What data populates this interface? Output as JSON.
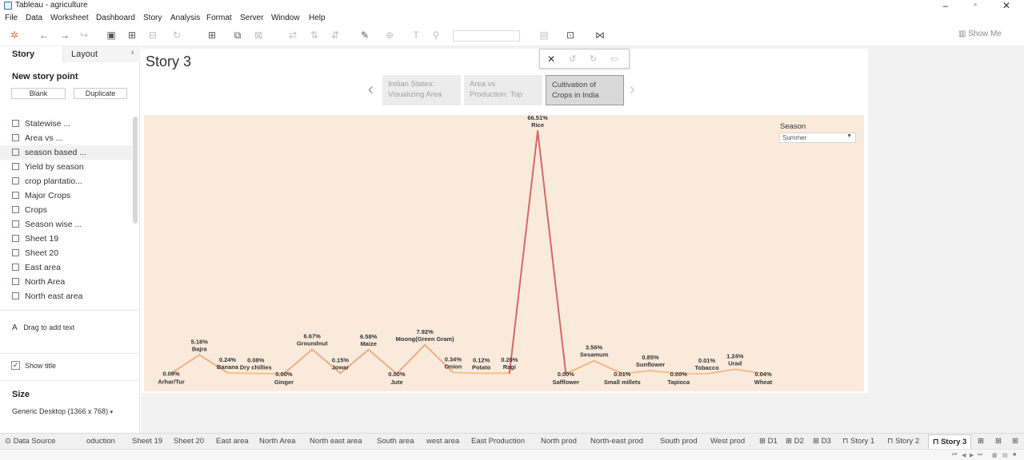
{
  "window": {
    "title": "Tableau - agriculture"
  },
  "menu": [
    "File",
    "Data",
    "Worksheet",
    "Dashboard",
    "Story",
    "Analysis",
    "Format",
    "Server",
    "Window",
    "Help"
  ],
  "toolbar": {
    "show_me": "Show Me"
  },
  "left_panel": {
    "tab_story": "Story",
    "tab_layout": "Layout",
    "new_story_point": "New story point",
    "blank_button": "Blank",
    "duplicate_button": "Duplicate",
    "sheets": [
      "Statewise ...",
      "Area vs ...",
      "season based ...",
      "Yield by season",
      "crop plantatio...",
      "Major Crops",
      "Crops",
      "Season wise ...",
      "Sheet 19",
      "Sheet 20",
      "East area",
      "North Area",
      "North east area"
    ],
    "drag_text": "Drag to add text",
    "show_title_label": "Show title",
    "size_heading": "Size",
    "size_value": "Generic Desktop (1366 x 768)"
  },
  "story": {
    "title": "Story 3",
    "points": [
      {
        "line1": "Indian States:",
        "line2": "Visualizing Area"
      },
      {
        "line1": "Area vs",
        "line2": "Production: Top"
      },
      {
        "line1": "Cultivation of",
        "line2": "Crops in India"
      }
    ]
  },
  "filter": {
    "label": "Season",
    "value": "Summer"
  },
  "chart_data": {
    "type": "line",
    "categories": [
      "Arhar/Tur",
      "Bajra",
      "Banana",
      "Dry chillies",
      "Ginger",
      "Groundnut",
      "Jowar",
      "Maize",
      "Jute",
      "Moong(Green Gram)",
      "Onion",
      "Potato",
      "Ragi",
      "Rice",
      "Safflower",
      "Sesamum",
      "Small millets",
      "Sunflower",
      "Tapioca",
      "Tobacco",
      "Urad",
      "Wheat"
    ],
    "values": [
      0.09,
      5.18,
      0.24,
      0.08,
      0.0,
      6.67,
      0.15,
      6.58,
      0.0,
      7.92,
      0.34,
      0.12,
      0.2,
      66.51,
      0.0,
      3.56,
      0.01,
      0.85,
      0.0,
      0.01,
      1.24,
      0.04
    ],
    "data_labels": [
      "0.09%",
      "5.18%",
      "0.24%",
      "0.08%",
      "0.00%",
      "6.67%",
      "0.15%",
      "6.58%",
      "0.00%",
      "7.92%",
      "0.34%",
      "0.12%",
      "0.20%",
      "66.51%",
      "0.00%",
      "3.56%",
      "0.01%",
      "0.85%",
      "0.00%",
      "0.01%",
      "1.24%",
      "0.04%"
    ],
    "label_position": [
      "below",
      "above",
      "above",
      "above",
      "below",
      "above",
      "above",
      "above",
      "below",
      "above",
      "above",
      "above",
      "above",
      "above",
      "below",
      "above",
      "below",
      "above",
      "below",
      "above",
      "above",
      "below"
    ],
    "ylim": [
      0,
      66.51
    ],
    "grid": false,
    "colors": {
      "low": "#f7c58a",
      "high": "#d66868",
      "background": "#f9eadc"
    }
  },
  "sheet_tabs": [
    "Data Source",
    "oduction",
    "Sheet 19",
    "Sheet 20",
    "East area",
    "North Area",
    "North east area",
    "South area",
    "west area",
    "East Production",
    "North prod",
    "North-east prod",
    "South prod",
    "West prod",
    "D1",
    "D2",
    "D3",
    "Story 1",
    "Story 2",
    "Story 3"
  ]
}
